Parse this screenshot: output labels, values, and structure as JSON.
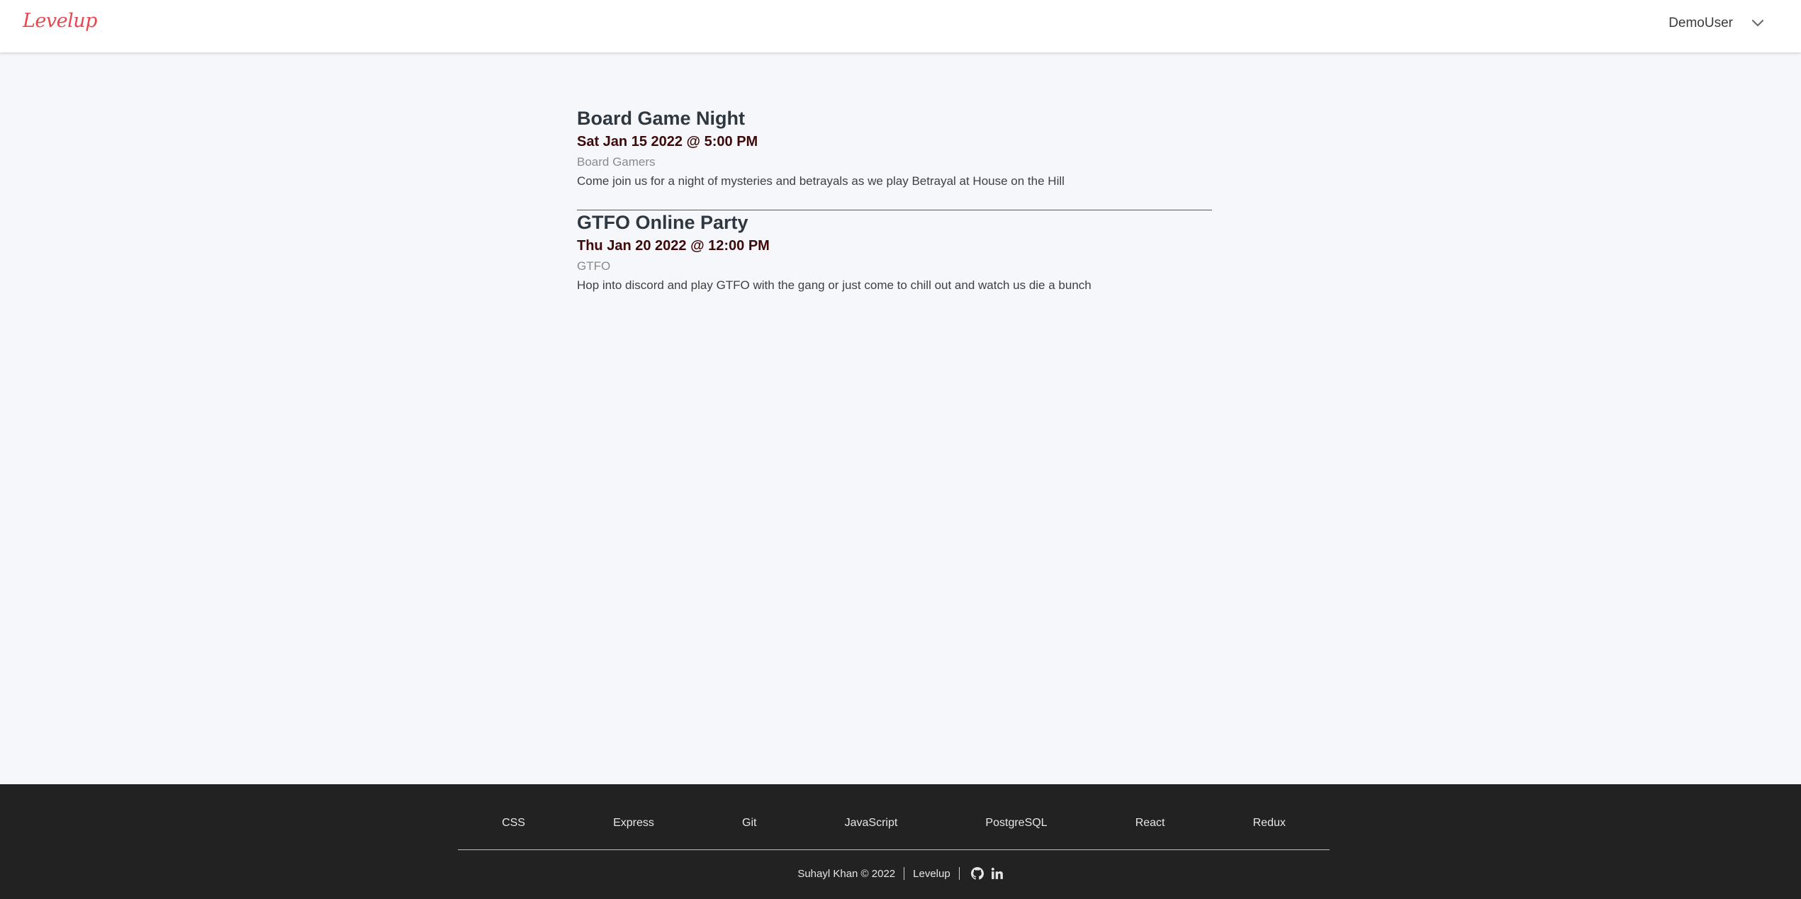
{
  "header": {
    "logo": "Levelup",
    "username": "DemoUser",
    "menu_icon": "chevron-down-icon"
  },
  "events": [
    {
      "title": "Board Game Night",
      "date": "Sat Jan 15 2022 @ 5:00 PM",
      "group": "Board Gamers",
      "description": "Come join us for a night of mysteries and betrayals as we play Betrayal at House on the Hill"
    },
    {
      "title": "GTFO Online Party",
      "date": "Thu Jan 20 2022 @ 12:00 PM",
      "group": "GTFO",
      "description": "Hop into discord and play GTFO with the gang or just come to chill out and watch us die a bunch"
    }
  ],
  "footer": {
    "technologies": [
      "CSS",
      "Express",
      "Git",
      "JavaScript",
      "PostgreSQL",
      "React",
      "Redux"
    ],
    "copyright": "Suhayl Khan © 2022",
    "app_link": "Levelup",
    "icons": [
      "github-icon",
      "linkedin-icon"
    ]
  },
  "colors": {
    "brand": "#e8474f",
    "background": "#f6f7fb",
    "footer_bg": "#222222",
    "date_text": "#3d0a0a"
  }
}
